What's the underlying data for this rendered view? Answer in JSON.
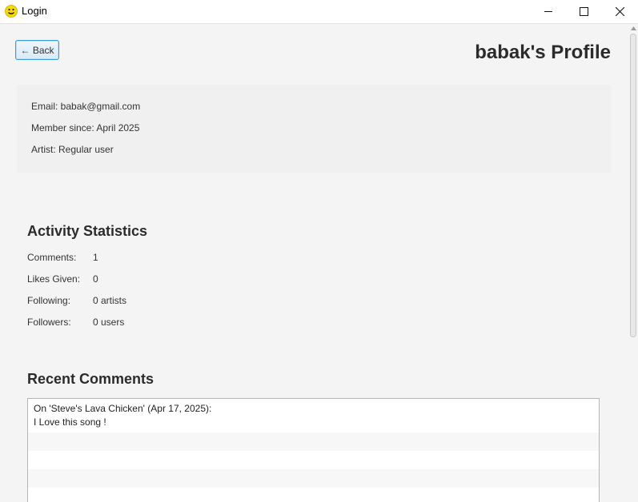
{
  "window": {
    "title": "Login"
  },
  "header": {
    "back_label": "← Back",
    "profile_title": "babak's Profile"
  },
  "info": {
    "email": "Email: babak@gmail.com",
    "member_since": "Member since: April 2025",
    "artist": "Artist: Regular user"
  },
  "stats": {
    "title": "Activity Statistics",
    "rows": [
      {
        "label": "Comments:",
        "value": "1"
      },
      {
        "label": "Likes Given:",
        "value": "0"
      },
      {
        "label": "Following:",
        "value": "0 artists"
      },
      {
        "label": "Followers:",
        "value": "0 users"
      }
    ]
  },
  "comments": {
    "title": "Recent Comments",
    "items": [
      {
        "line1": "On 'Steve's Lava Chicken' (Apr 17, 2025):",
        "line2": "I Love this song !"
      }
    ]
  },
  "colors": {
    "accent_border": "#3b9bd6",
    "background": "#f4f4f4"
  }
}
